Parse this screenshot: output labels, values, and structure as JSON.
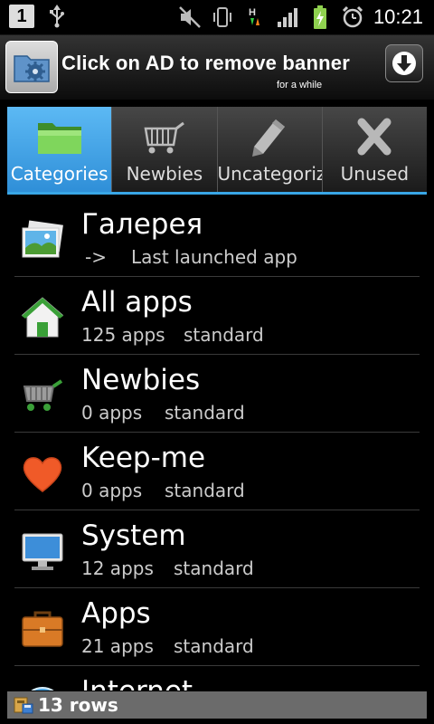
{
  "status_bar": {
    "notification_count": "1",
    "time": "10:21",
    "icons": [
      "usb-icon",
      "mute-icon",
      "vibrate-icon",
      "data-transfer-icon",
      "signal-icon",
      "battery-charging-icon",
      "alarm-icon"
    ],
    "data_label": "H"
  },
  "ad_banner": {
    "text": "Click on AD to remove banner",
    "subtext": "for a while"
  },
  "tabs": [
    {
      "label": "Categories",
      "icon": "folder-icon",
      "active": true
    },
    {
      "label": "Newbies",
      "icon": "shopping-cart-icon",
      "active": false
    },
    {
      "label": "Uncategorized",
      "icon": "pencil-icon",
      "active": false
    },
    {
      "label": "Unused",
      "icon": "x-icon",
      "active": false
    }
  ],
  "list": [
    {
      "title": "Галерея",
      "count": "->",
      "type": "Last launched app",
      "icon": "gallery-icon"
    },
    {
      "title": "All apps",
      "count": "125 apps",
      "type": "standard",
      "icon": "home-icon"
    },
    {
      "title": "Newbies",
      "count": "0 apps",
      "type": "standard",
      "icon": "cart-icon"
    },
    {
      "title": "Keep-me",
      "count": "0 apps",
      "type": "standard",
      "icon": "heart-icon"
    },
    {
      "title": "System",
      "count": "12 apps",
      "type": "standard",
      "icon": "monitor-icon"
    },
    {
      "title": "Apps",
      "count": "21 apps",
      "type": "standard",
      "icon": "briefcase-icon"
    },
    {
      "title": "Internet",
      "count": "",
      "type": "",
      "icon": "globe-icon"
    }
  ],
  "footer": {
    "text": "13 rows",
    "icon": "database-icon"
  },
  "colors": {
    "active_tab": "#3a9ee4",
    "tab_underline": "#39a6e6",
    "footer_bg": "#6b6b6b"
  }
}
